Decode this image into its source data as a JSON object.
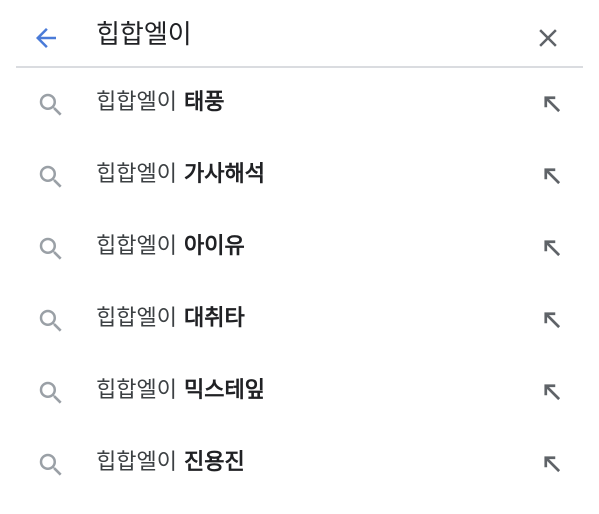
{
  "search": {
    "query": "힙합엘이",
    "back_icon": "arrow-left-icon",
    "clear_icon": "close-icon",
    "accent_color": "#4a7bd8"
  },
  "suggestions": [
    {
      "prefix": "힙합엘이",
      "completion": "태풍"
    },
    {
      "prefix": "힙합엘이",
      "completion": "가사해석"
    },
    {
      "prefix": "힙합엘이",
      "completion": "아이유"
    },
    {
      "prefix": "힙합엘이",
      "completion": "대취타"
    },
    {
      "prefix": "힙합엘이",
      "completion": "믹스테잎"
    },
    {
      "prefix": "힙합엘이",
      "completion": "진용진"
    }
  ],
  "icons": {
    "suggestion_leading": "search-icon",
    "suggestion_trailing": "arrow-up-left-icon"
  }
}
